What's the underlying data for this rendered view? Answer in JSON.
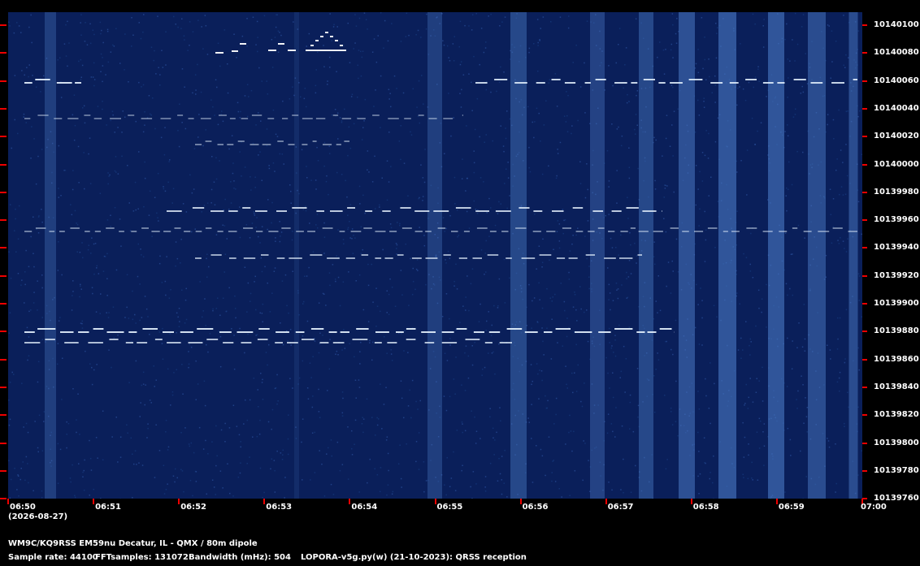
{
  "station_line": "WM9C/KQ9RSS EM59nu Decatur, IL - QMX / 80m dipole",
  "date_label": "(2026-08-27)",
  "info": {
    "sample_rate": "Sample rate: 44100",
    "fft_samples": "FFTsamples: 131072",
    "bandwidth": "Bandwidth (mHz): 504",
    "software": "LOPORA-v5g.py(w) (21-10-2023): QRSS reception"
  },
  "freq_labels": [
    "10140100",
    "10140080",
    "10140060",
    "10140040",
    "10140020",
    "10140000",
    "10139980",
    "10139960",
    "10139940",
    "10139920",
    "10139900",
    "10139880",
    "10139860",
    "10139840",
    "10139820",
    "10139800",
    "10139780",
    "10139760"
  ],
  "time_labels": [
    "06:50",
    "06:51",
    "06:52",
    "06:53",
    "06:54",
    "06:55",
    "06:56",
    "06:57",
    "06:58",
    "06:59",
    "07:00"
  ],
  "colors": {
    "background": "#000000",
    "waterfall": "#0a1f5a",
    "tick": "#e00000",
    "signal": "#e8f4ff"
  }
}
